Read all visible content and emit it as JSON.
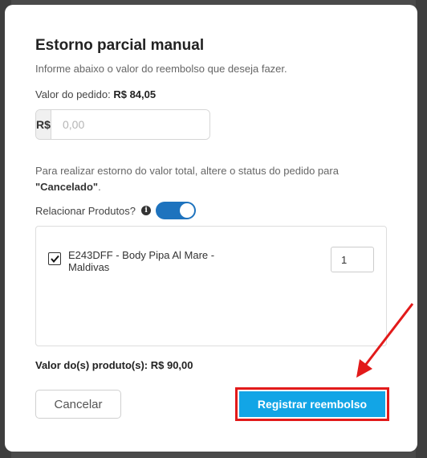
{
  "modal": {
    "title": "Estorno parcial manual",
    "subtitle": "Informe abaixo o valor do reembolso que deseja fazer.",
    "order_value_label": "Valor do pedido:",
    "order_value": "R$ 84,05",
    "currency_prefix": "R$",
    "amount_placeholder": "0,00",
    "info_text_part1": "Para realizar estorno do valor total, altere o status do pedido para",
    "info_text_status": "\"Cancelado\"",
    "info_text_end": ".",
    "relate_products_label": "Relacionar Produtos?",
    "relate_products_enabled": true,
    "products": [
      {
        "name": "E243DFF - Body Pipa Al Mare - Maldivas",
        "checked": true,
        "quantity": "1"
      }
    ],
    "products_total_label": "Valor do(s) produto(s):",
    "products_total_value": "R$ 90,00",
    "cancel_label": "Cancelar",
    "register_label": "Registrar reembolso"
  },
  "colors": {
    "primary_button": "#12a5e6",
    "toggle_on": "#1e73be",
    "highlight_annotation": "#e21a1a"
  }
}
